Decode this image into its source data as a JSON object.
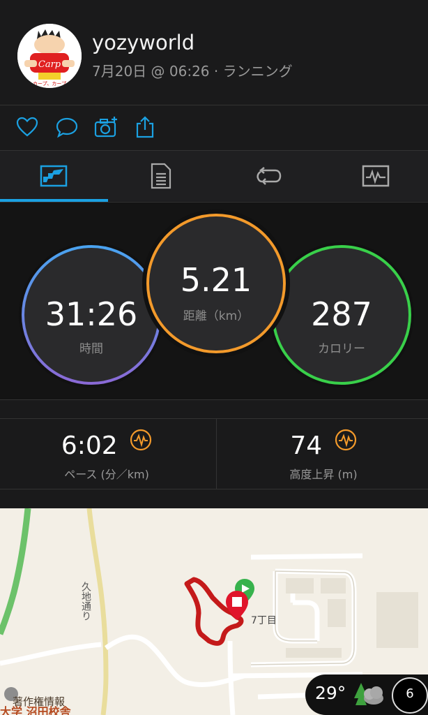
{
  "header": {
    "username": "yozyworld",
    "meta": "7月20日 @ 06:26 · ランニング"
  },
  "actions": [
    "heart-icon",
    "comment-icon",
    "add-photo-icon",
    "share-icon"
  ],
  "tabs": [
    "overview-tab",
    "details-tab",
    "laps-tab",
    "charts-tab"
  ],
  "stats": {
    "time": {
      "value": "31:26",
      "label": "時間",
      "color": "#4aa3f0"
    },
    "distance": {
      "value": "5.21",
      "label": "距離（km）",
      "color": "#f39a2b"
    },
    "calories": {
      "value": "287",
      "label": "カロリー",
      "color": "#39d04a"
    }
  },
  "metrics": {
    "pace": {
      "value": "6:02",
      "label": "ペース (分／km)"
    },
    "elevation": {
      "value": "74",
      "label": "高度上昇 (m)"
    }
  },
  "map": {
    "road_label": "久地通り",
    "area_label": "7丁目",
    "poi_label": "著作権情報",
    "bottom_label": "大学 沼田校舎"
  },
  "weather": {
    "temperature": "29°",
    "badge": "6"
  }
}
